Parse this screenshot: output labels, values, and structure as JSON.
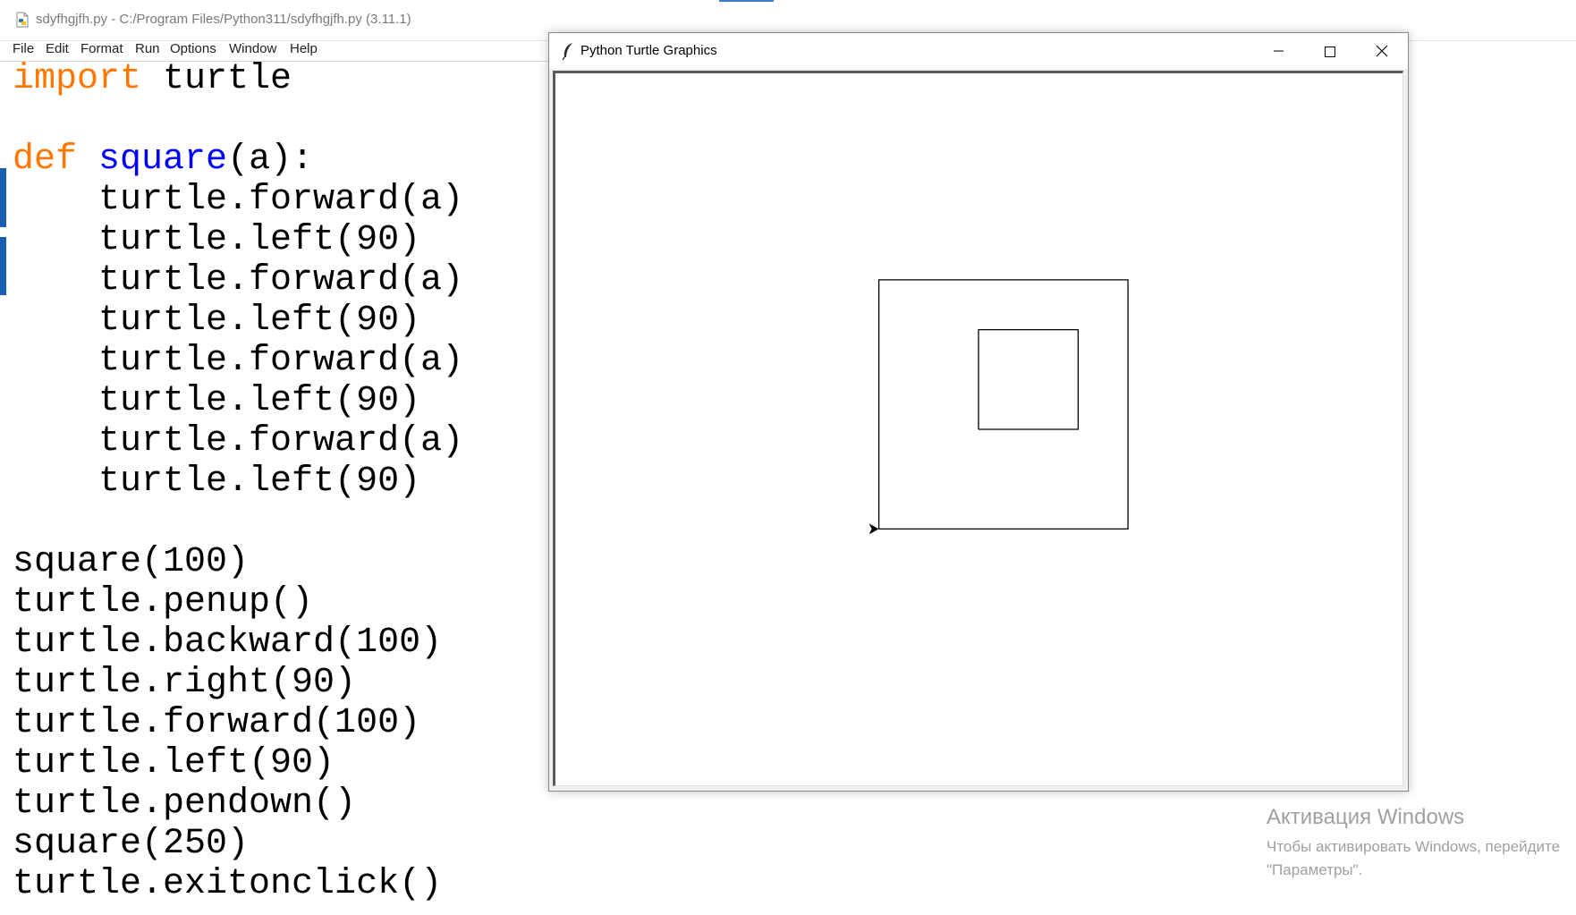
{
  "idle": {
    "title": "sdyfhgjfh.py - C:/Program Files/Python311/sdyfhgjfh.py (3.11.1)",
    "menu": [
      "File",
      "Edit",
      "Format",
      "Run",
      "Options",
      "Window",
      "Help"
    ]
  },
  "code": [
    [
      {
        "t": "import",
        "c": "kw"
      },
      {
        "t": " turtle"
      }
    ],
    [],
    [
      {
        "t": "def",
        "c": "kw"
      },
      {
        "t": " "
      },
      {
        "t": "square",
        "c": "fn"
      },
      {
        "t": "(a):"
      }
    ],
    [
      {
        "t": "    turtle.forward(a)"
      }
    ],
    [
      {
        "t": "    turtle.left(90)"
      }
    ],
    [
      {
        "t": "    turtle.forward(a)"
      }
    ],
    [
      {
        "t": "    turtle.left(90)"
      }
    ],
    [
      {
        "t": "    turtle.forward(a)"
      }
    ],
    [
      {
        "t": "    turtle.left(90)"
      }
    ],
    [
      {
        "t": "    turtle.forward(a)"
      }
    ],
    [
      {
        "t": "    turtle.left(90)"
      }
    ],
    [],
    [
      {
        "t": "square(100)"
      }
    ],
    [
      {
        "t": "turtle.penup()"
      }
    ],
    [
      {
        "t": "turtle.backward(100)"
      }
    ],
    [
      {
        "t": "turtle.right(90)"
      }
    ],
    [
      {
        "t": "turtle.forward(100)"
      }
    ],
    [
      {
        "t": "turtle.left(90)"
      }
    ],
    [
      {
        "t": "turtle.pendown()"
      }
    ],
    [
      {
        "t": "square(250)"
      }
    ],
    [
      {
        "t": "turtle.exitonclick()"
      }
    ]
  ],
  "turtle_window": {
    "title": "Python Turtle Graphics",
    "squares": [
      100,
      250
    ]
  },
  "activation": {
    "line1": "Активация Windows",
    "line2": "Чтобы активировать Windows, перейдите",
    "line3": "\"Параметры\"."
  },
  "colors": {
    "keyword": "#ff7700",
    "builtin": "#0000ff",
    "accent": "#1a5fb4"
  }
}
